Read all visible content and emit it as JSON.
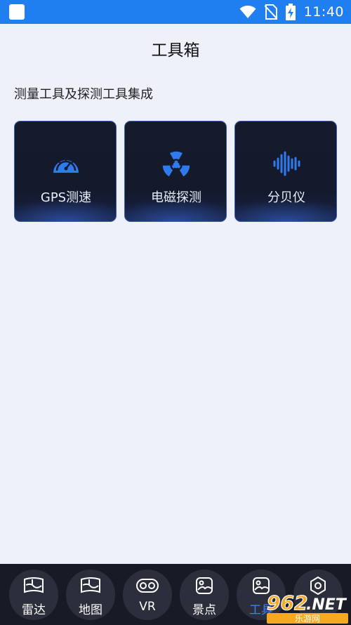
{
  "status_bar": {
    "time": "11:40",
    "icons": [
      "wifi-icon",
      "no-sim-icon",
      "battery-charging-icon"
    ],
    "background": "#1f7ef0"
  },
  "header": {
    "title": "工具箱"
  },
  "section": {
    "title": "测量工具及探测工具集成"
  },
  "tools": [
    {
      "label": "GPS测速",
      "icon": "speedometer-icon"
    },
    {
      "label": "电磁探测",
      "icon": "radiation-icon"
    },
    {
      "label": "分贝仪",
      "icon": "sound-wave-icon"
    }
  ],
  "bottom_nav": {
    "items": [
      {
        "label": "雷达",
        "icon": "map-icon",
        "active": false
      },
      {
        "label": "地图",
        "icon": "map-icon",
        "active": false
      },
      {
        "label": "VR",
        "icon": "vr-goggles-icon",
        "active": false
      },
      {
        "label": "景点",
        "icon": "picture-icon",
        "active": false
      },
      {
        "label": "工具",
        "icon": "picture-icon",
        "active": true
      },
      {
        "label": "",
        "icon": "settings-icon",
        "active": false
      }
    ],
    "active_color": "#3c82f0"
  },
  "watermark": {
    "text": "962.NET",
    "subtext": "乐游网"
  },
  "colors": {
    "accent": "#2f7bee",
    "card_bg": "#151a2d",
    "page_bg": "#eef1f9"
  }
}
